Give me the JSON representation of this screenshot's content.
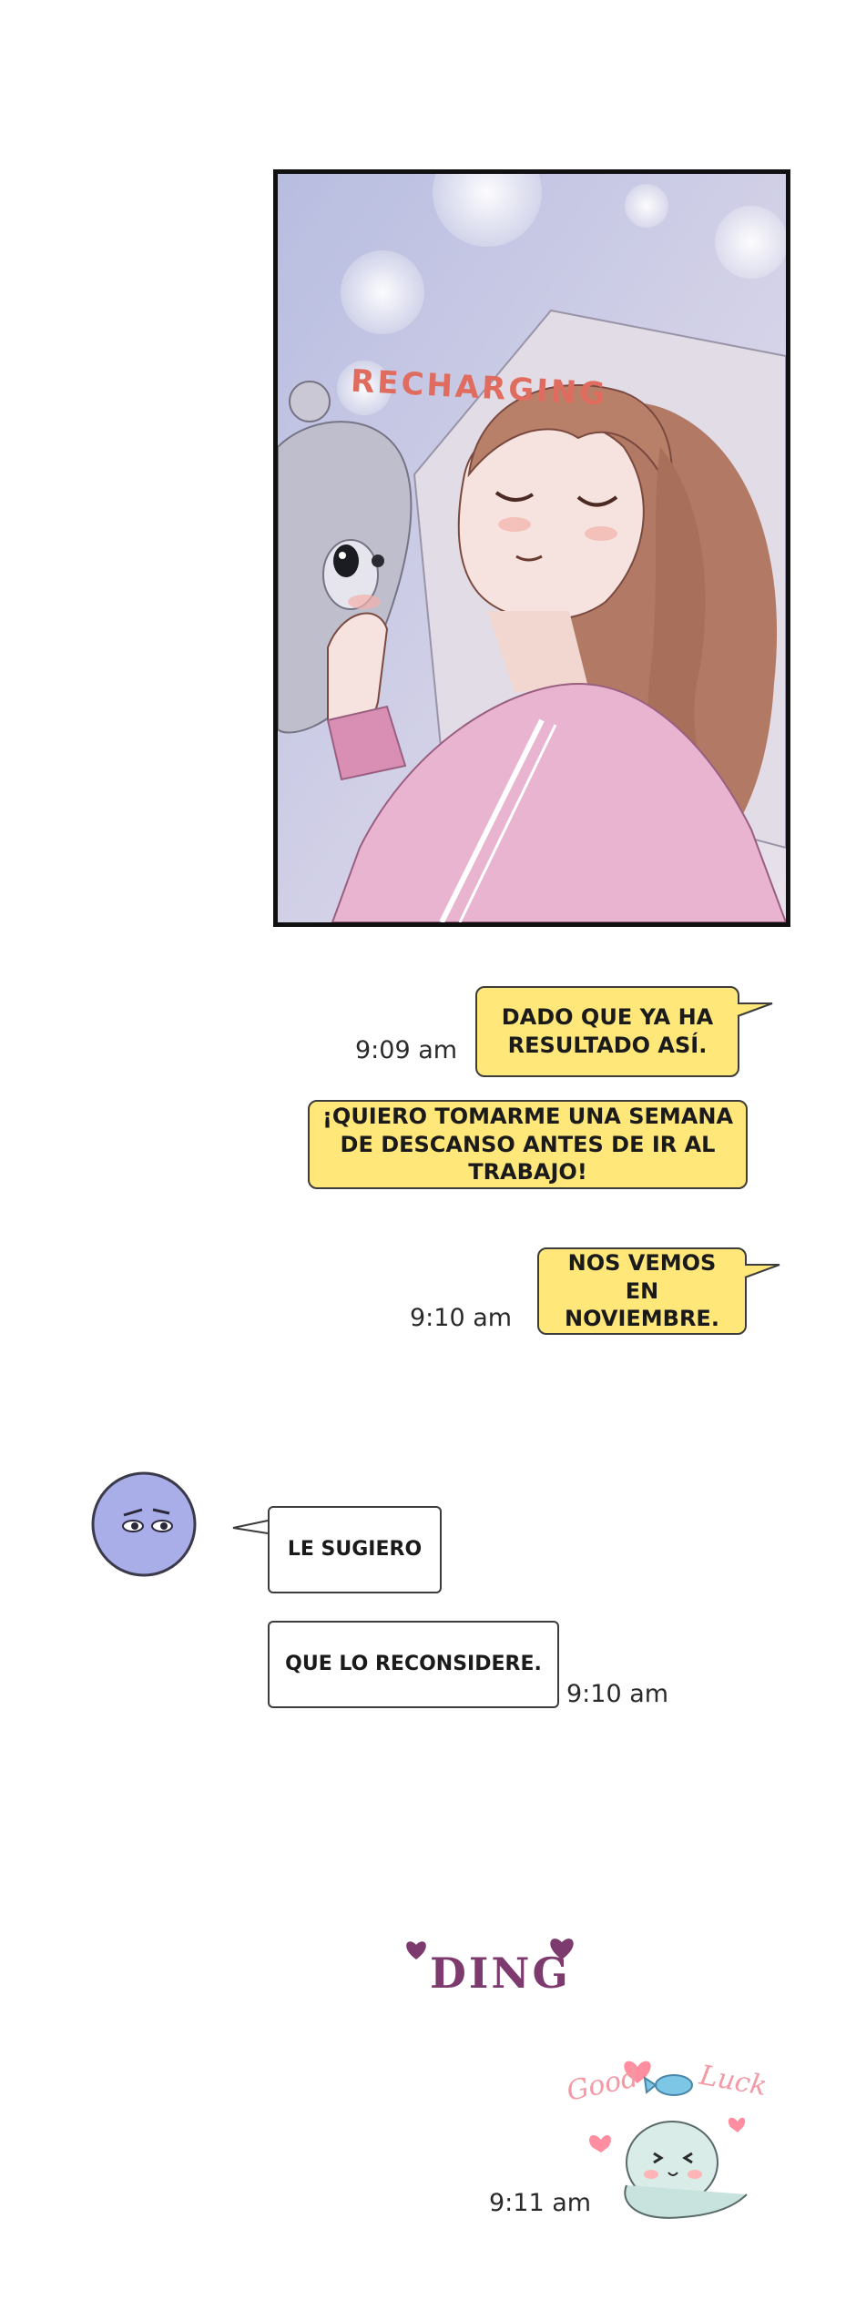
{
  "panel": {
    "sfx": "RECHARGING"
  },
  "messages": {
    "m1": "DADO QUE YA HA RESULTADO ASÍ.",
    "m1_time": "9:09 am",
    "m2": "¡QUIERO TOMARME UNA SEMANA DE DESCANSO ANTES DE IR AL TRABAJO!",
    "m3": "NOS VEMOS EN NOVIEMBRE.",
    "m3_time": "9:10 am",
    "r1": "LE SUGIERO",
    "r2": "QUE LO RECONSIDERE.",
    "r2_time": "9:10 am",
    "ding": "DING",
    "sticker_text_1": "Good",
    "sticker_text_2": "Luck",
    "sticker_time": "9:11 am"
  },
  "colors": {
    "bubble_yellow": "#ffe77a",
    "sfx": "#e06c60",
    "ding": "#7d3a6e",
    "avatar": "#a9aee8"
  }
}
